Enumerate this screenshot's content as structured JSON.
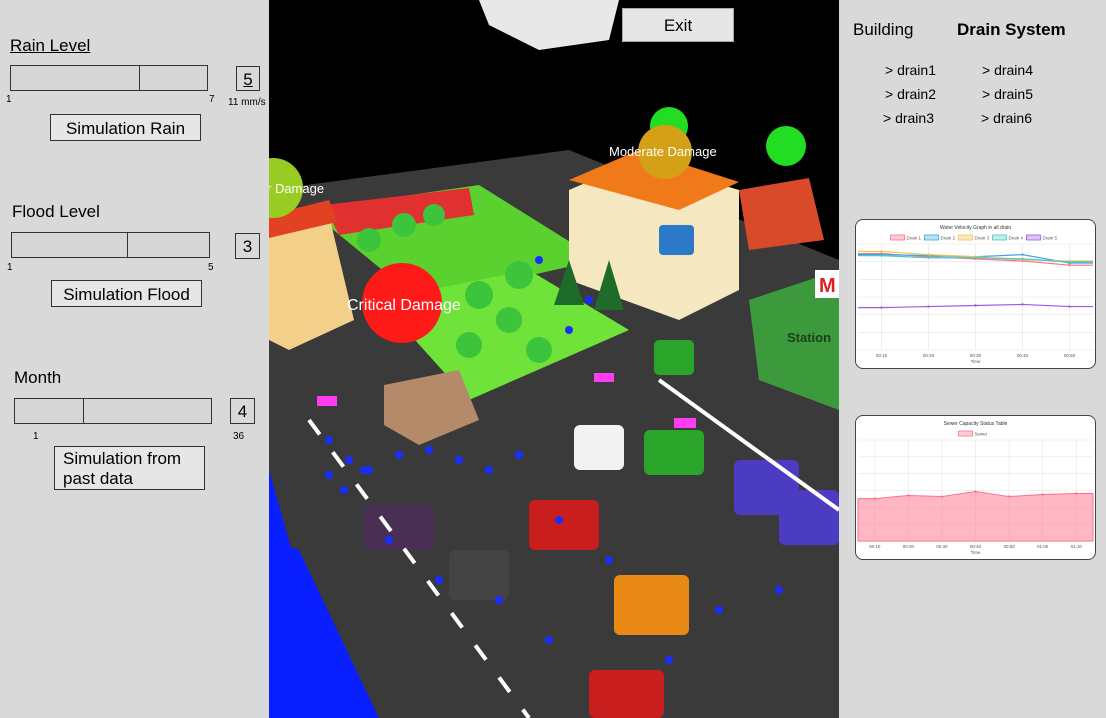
{
  "controls": {
    "rain": {
      "title": "Rain Level",
      "min": "1",
      "max": "7",
      "value": "5",
      "unit": "11 mm/s",
      "button": "Simulation Rain"
    },
    "flood": {
      "title": "Flood Level",
      "min": "1",
      "max": "5",
      "value": "3",
      "button": "Simulation Flood"
    },
    "month": {
      "title": "Month",
      "min": "1",
      "max": "36",
      "value": "4",
      "button_line1": "Simulation from",
      "button_line2": "past data"
    }
  },
  "scene": {
    "exit_label": "Exit",
    "labels": {
      "moderate": "Moderate Damage",
      "critical": "Critical Damage",
      "minor_partial": "r Damage",
      "station": "Station",
      "store_sign": "M"
    }
  },
  "right": {
    "tab_building": "Building",
    "tab_drain": "Drain System",
    "drains": [
      "> drain1",
      "> drain4",
      "> drain2",
      "> drain5",
      "> drain3",
      "> drain6"
    ]
  },
  "chart_data": [
    {
      "type": "line",
      "title": "Water Velocity Graph in all drain",
      "xlabel": "Time",
      "ylabel": "",
      "x": [
        "00:10",
        "00:20",
        "00:30",
        "00:40",
        "00:50"
      ],
      "series": [
        {
          "name": "Drain 1",
          "color": "#ff6f8a",
          "values": [
            0.91,
            0.88,
            0.86,
            0.84,
            0.8
          ]
        },
        {
          "name": "Drain 2",
          "color": "#3fa7e6",
          "values": [
            0.9,
            0.89,
            0.88,
            0.9,
            0.82
          ]
        },
        {
          "name": "Drain 3",
          "color": "#f2c14e",
          "values": [
            0.93,
            0.9,
            0.88,
            0.85,
            0.84
          ]
        },
        {
          "name": "Drain 4",
          "color": "#4cc9c0",
          "values": [
            0.89,
            0.87,
            0.87,
            0.86,
            0.83
          ]
        },
        {
          "name": "Drain 5",
          "color": "#9b59e6",
          "values": [
            0.4,
            0.41,
            0.42,
            0.43,
            0.41
          ]
        }
      ],
      "ylim": [
        0,
        1
      ],
      "grid": true,
      "legend": "top"
    },
    {
      "type": "area",
      "title": "Sewer Capacity Status Table",
      "xlabel": "Time",
      "ylabel": "",
      "x": [
        "00:10",
        "00:20",
        "00:30",
        "00:40",
        "00:50",
        "01:00",
        "01:10"
      ],
      "series": [
        {
          "name": "Sewer",
          "color": "#ff6f8a",
          "values": [
            0.42,
            0.45,
            0.44,
            0.49,
            0.44,
            0.46,
            0.47
          ]
        }
      ],
      "ylim": [
        0,
        1
      ],
      "grid": true,
      "legend": "top"
    }
  ]
}
